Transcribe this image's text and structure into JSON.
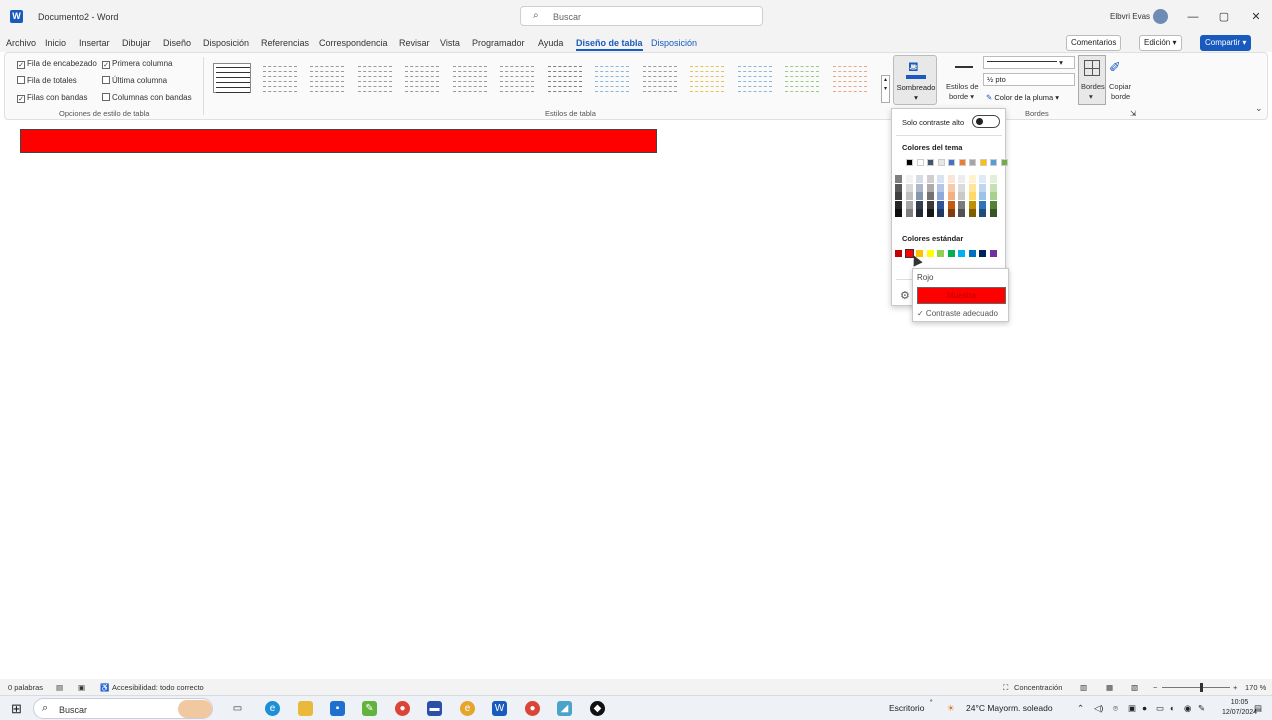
{
  "app": {
    "logo_letter": "W",
    "title": "Documento2 - Word",
    "search_placeholder": "Buscar",
    "user_name": "Elbvri Evas",
    "window_controls": [
      "—",
      "▢",
      "✕"
    ]
  },
  "tabs": [
    "Archivo",
    "Inicio",
    "Insertar",
    "Dibujar",
    "Diseño",
    "Disposición",
    "Referencias",
    "Correspondencia",
    "Revisar",
    "Vista",
    "Programador",
    "Ayuda",
    "Diseño de tabla",
    "Disposición"
  ],
  "active_tab": "Diseño de tabla",
  "toolbar_right": {
    "comments": "Comentarios",
    "edit": "Edición",
    "share": "Compartir"
  },
  "style_options": {
    "items": [
      {
        "label": "Fila de encabezado",
        "checked": true
      },
      {
        "label": "Primera columna",
        "checked": true
      },
      {
        "label": "Fila de totales",
        "checked": false
      },
      {
        "label": "Última columna",
        "checked": false
      },
      {
        "label": "Filas con bandas",
        "checked": true
      },
      {
        "label": "Columnas con bandas",
        "checked": false
      }
    ],
    "group_label": "Opciones de estilo de tabla"
  },
  "table_styles": {
    "group_label": "Estilos de tabla",
    "thumb_colors": [
      "#333333",
      "#9a9a9a",
      "#9a9a9a",
      "#9a9a9a",
      "#9a9a9a",
      "#9a9a9a",
      "#9a9a9a",
      "#7f7f7f",
      "#8fb4de",
      "#9a9a9a",
      "#e8c25a",
      "#8fb4de",
      "#9cc98a",
      "#e8a98a"
    ]
  },
  "borders": {
    "shading_label": "Sombreado",
    "border_styles_label_1": "Estilos de",
    "border_styles_label_2": "borde",
    "line_weight": "½ pto",
    "pen_color": "Color de la pluma",
    "borders_label": "Bordes",
    "copy_label_1": "Copiar",
    "copy_label_2": "borde",
    "group_label": "Bordes"
  },
  "shading_menu": {
    "high_contrast_label": "Solo contraste alto",
    "theme_colors_label": "Colores del tema",
    "standard_colors_label": "Colores estándar",
    "theme_top_row": [
      "#000000",
      "#ffffff",
      "#44546a",
      "#e7e6e6",
      "#4472c4",
      "#ed7d31",
      "#a5a5a5",
      "#ffc000",
      "#5b9bd5",
      "#70ad47"
    ],
    "theme_columns": [
      [
        "#7f7f7f",
        "#595959",
        "#404040",
        "#262626",
        "#0d0d0d"
      ],
      [
        "#f2f2f2",
        "#d9d9d9",
        "#bfbfbf",
        "#a6a6a6",
        "#7f7f7f"
      ],
      [
        "#d6dce4",
        "#adb9ca",
        "#8497b0",
        "#333f4f",
        "#222a35"
      ],
      [
        "#d0cece",
        "#aeabab",
        "#757171",
        "#3a3838",
        "#171616"
      ],
      [
        "#d9e2f3",
        "#b4c6e7",
        "#8eaadb",
        "#2f5496",
        "#1f3864"
      ],
      [
        "#fbe5d5",
        "#f7caac",
        "#f4b083",
        "#c55a11",
        "#833c0b"
      ],
      [
        "#ededed",
        "#dbdbdb",
        "#c9c9c9",
        "#7b7b7b",
        "#525252"
      ],
      [
        "#fff2cc",
        "#fee599",
        "#ffd965",
        "#bf9000",
        "#7f6000"
      ],
      [
        "#deebf6",
        "#bdd7ee",
        "#9cc3e5",
        "#2e75b5",
        "#1f4e79"
      ],
      [
        "#e2efd9",
        "#c5e0b3",
        "#a8d08d",
        "#538135",
        "#375623"
      ]
    ],
    "standard_colors": [
      "#c00000",
      "#ff0000",
      "#ffc000",
      "#ffff00",
      "#92d050",
      "#00b050",
      "#00b0f0",
      "#0070c0",
      "#002060",
      "#7030a0"
    ],
    "tooltip": {
      "name": "Rojo",
      "sample": "Muestra",
      "contrast": "✓ Contraste adecuado"
    }
  },
  "statusbar": {
    "words": "0 palabras",
    "accessibility": "Accesibilidad: todo correcto",
    "focus": "Concentración",
    "zoom": "170 %"
  },
  "taskbar": {
    "search": "Buscar",
    "desktop": "Escritorio",
    "weather": "24°C  Mayorm. soleado",
    "time": "10:05",
    "date": "12/07/2024"
  }
}
